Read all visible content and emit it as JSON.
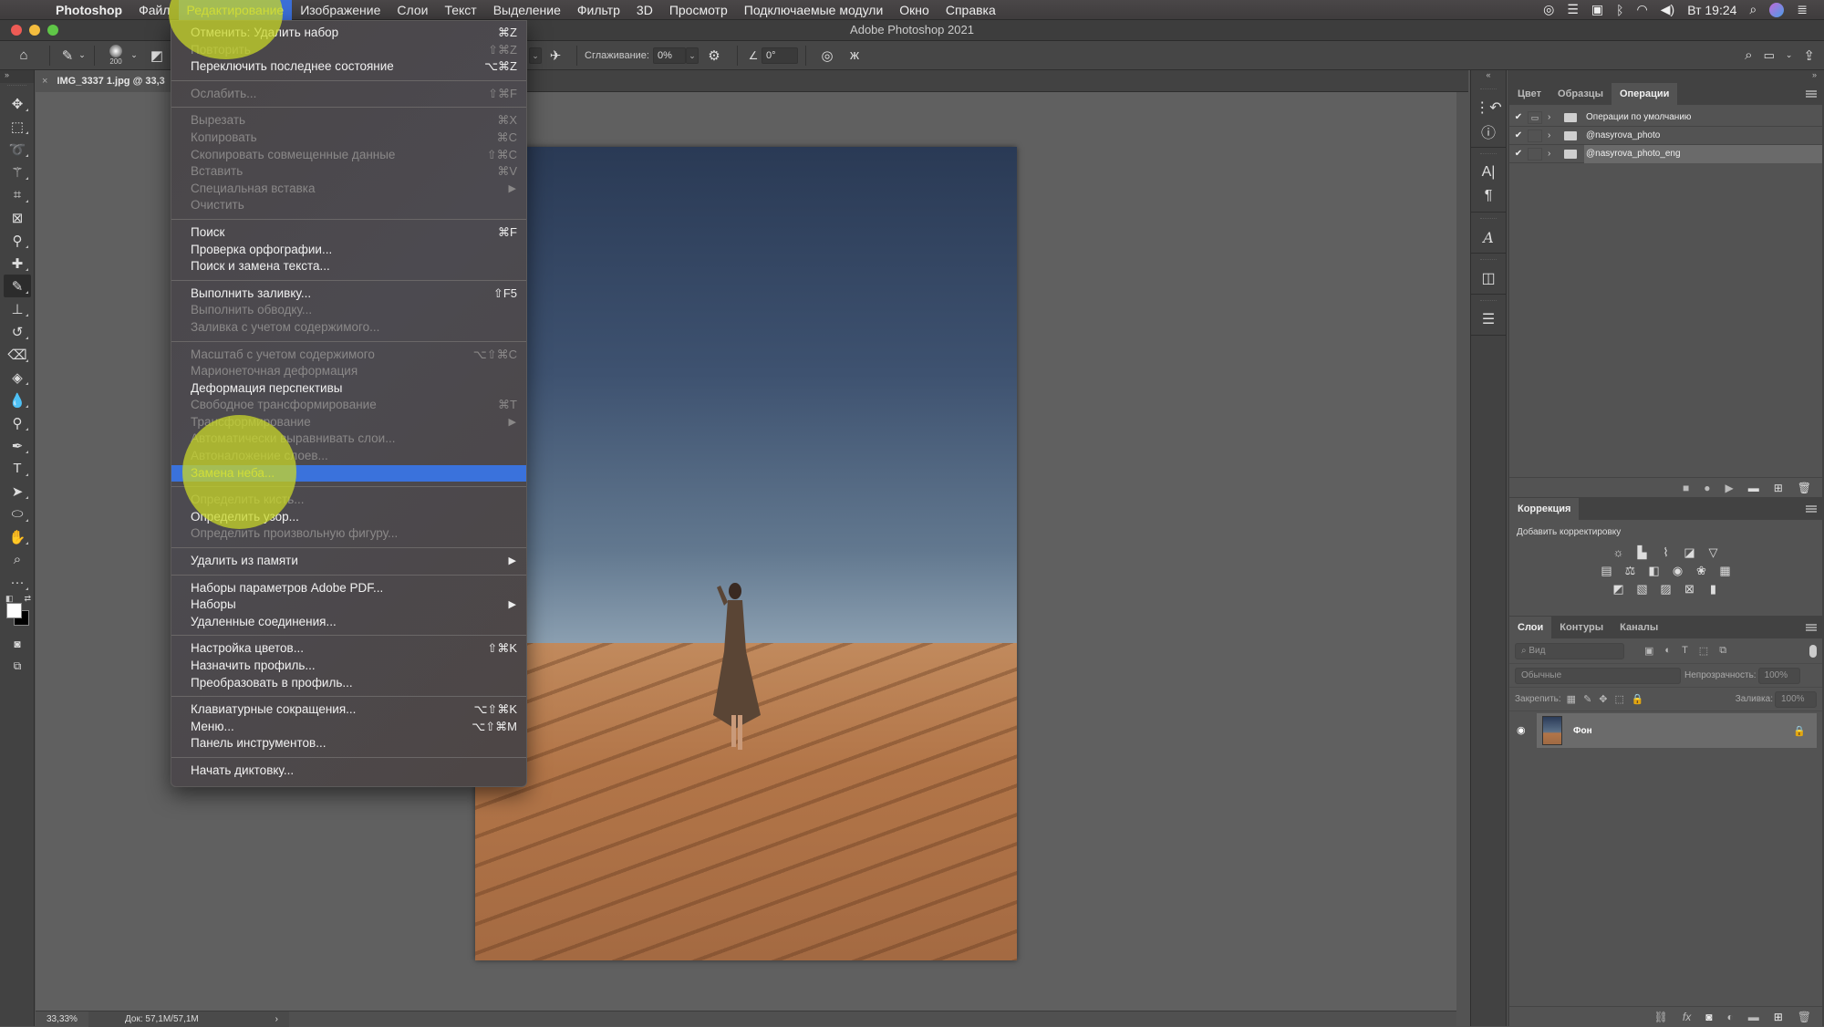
{
  "menubar": {
    "apple_icon": "apple-logo-icon",
    "app_name": "Photoshop",
    "items": [
      "Файл",
      "Редактирование",
      "Изображение",
      "Слои",
      "Текст",
      "Выделение",
      "Фильтр",
      "3D",
      "Просмотр",
      "Подключаемые модули",
      "Окно",
      "Справка"
    ],
    "active_item": "Редактирование",
    "status_icons": [
      "creative-cloud-icon",
      "drive-icon",
      "screenshot-app-icon",
      "bluetooth-icon",
      "wifi-icon",
      "volume-icon"
    ],
    "clock": "Вт 19:24",
    "right_icons": [
      "spotlight-icon",
      "siri-icon",
      "notification-center-icon"
    ]
  },
  "window": {
    "title": "Adobe Photoshop 2021"
  },
  "options_bar": {
    "brush_size": "200",
    "smoothing_label": "Сглаживание:",
    "smoothing_value": "0%",
    "angle_value": "0°"
  },
  "document": {
    "tab_title": "IMG_3337 1.jpg @ 33,3",
    "close_glyph": "×"
  },
  "status_bar": {
    "zoom": "33,33%",
    "doc_info": "Док: 57,1M/57,1M",
    "chevron": "›"
  },
  "edit_menu": {
    "groups": [
      [
        {
          "label": "Отменить: Удалить набор",
          "shortcut": "⌘Z",
          "enabled": true
        },
        {
          "label": "Повторить",
          "shortcut": "⇧⌘Z",
          "enabled": false
        },
        {
          "label": "Переключить последнее состояние",
          "shortcut": "⌥⌘Z",
          "enabled": true
        }
      ],
      [
        {
          "label": "Ослабить...",
          "shortcut": "⇧⌘F",
          "enabled": false
        }
      ],
      [
        {
          "label": "Вырезать",
          "shortcut": "⌘X",
          "enabled": false
        },
        {
          "label": "Копировать",
          "shortcut": "⌘C",
          "enabled": false
        },
        {
          "label": "Скопировать совмещенные данные",
          "shortcut": "⇧⌘C",
          "enabled": false
        },
        {
          "label": "Вставить",
          "shortcut": "⌘V",
          "enabled": false
        },
        {
          "label": "Специальная вставка",
          "submenu": true,
          "enabled": false
        },
        {
          "label": "Очистить",
          "enabled": false
        }
      ],
      [
        {
          "label": "Поиск",
          "shortcut": "⌘F",
          "enabled": true
        },
        {
          "label": "Проверка орфографии...",
          "enabled": true
        },
        {
          "label": "Поиск и замена текста...",
          "enabled": true
        }
      ],
      [
        {
          "label": "Выполнить заливку...",
          "shortcut": "⇧F5",
          "enabled": true
        },
        {
          "label": "Выполнить обводку...",
          "enabled": false
        },
        {
          "label": "Заливка с учетом содержимого...",
          "enabled": false
        }
      ],
      [
        {
          "label": "Масштаб с учетом содержимого",
          "shortcut": "⌥⇧⌘C",
          "enabled": false
        },
        {
          "label": "Марионеточная деформация",
          "enabled": false
        },
        {
          "label": "Деформация перспективы",
          "enabled": true
        },
        {
          "label": "Свободное трансформирование",
          "shortcut": "⌘T",
          "enabled": false
        },
        {
          "label": "Трансформирование",
          "submenu": true,
          "enabled": false
        },
        {
          "label": "Автоматически выравнивать слои...",
          "enabled": false
        },
        {
          "label": "Автоналожение слоев...",
          "enabled": false
        },
        {
          "label": "Замена неба...",
          "enabled": true,
          "highlighted": true
        }
      ],
      [
        {
          "label": "Определить кисть...",
          "enabled": false
        },
        {
          "label": "Определить узор...",
          "enabled": true
        },
        {
          "label": "Определить произвольную фигуру...",
          "enabled": false
        }
      ],
      [
        {
          "label": "Удалить из памяти",
          "submenu": true,
          "enabled": true
        }
      ],
      [
        {
          "label": "Наборы параметров Adobe PDF...",
          "enabled": true
        },
        {
          "label": "Наборы",
          "submenu": true,
          "enabled": true
        },
        {
          "label": "Удаленные соединения...",
          "enabled": true
        }
      ],
      [
        {
          "label": "Настройка цветов...",
          "shortcut": "⇧⌘K",
          "enabled": true
        },
        {
          "label": "Назначить профиль...",
          "enabled": true
        },
        {
          "label": "Преобразовать в профиль...",
          "enabled": true
        }
      ],
      [
        {
          "label": "Клавиатурные сокращения...",
          "shortcut": "⌥⇧⌘K",
          "enabled": true
        },
        {
          "label": "Меню...",
          "shortcut": "⌥⇧⌘M",
          "enabled": true
        },
        {
          "label": "Панель инструментов...",
          "enabled": true
        }
      ],
      [
        {
          "label": "Начать диктовку...",
          "enabled": true
        }
      ]
    ]
  },
  "toolbar": {
    "tools": [
      "move-tool",
      "marquee-tool",
      "lasso-tool",
      "magic-wand-tool",
      "crop-tool",
      "frame-tool",
      "eyedropper-tool",
      "healing-brush-tool",
      "brush-tool",
      "clone-stamp-tool",
      "history-brush-tool",
      "eraser-tool",
      "paint-bucket-tool",
      "blur-tool",
      "dodge-tool",
      "pen-tool",
      "type-tool",
      "path-selection-tool",
      "ellipse-tool",
      "hand-tool",
      "zoom-tool",
      "more-tools"
    ],
    "selected_tool": "brush-tool",
    "foreground_color": "#ffffff",
    "background_color": "#000000"
  },
  "actions_panel": {
    "tabs": [
      "Цвет",
      "Образцы",
      "Операции"
    ],
    "active_tab": "Операции",
    "sets": [
      {
        "name": "Операции по умолчанию",
        "checked": true,
        "selected": false
      },
      {
        "name": "@nasyrova_photo",
        "checked": true,
        "selected": false
      },
      {
        "name": "@nasyrova_photo_eng",
        "checked": true,
        "selected": true
      }
    ],
    "bottom_icons": [
      "stop-icon",
      "record-icon",
      "play-icon",
      "new-set-folder-icon",
      "new-action-icon",
      "delete-icon"
    ]
  },
  "adjustments_panel": {
    "tab": "Коррекция",
    "subtitle": "Добавить корректировку",
    "rows": [
      [
        "brightness-contrast-icon",
        "levels-icon",
        "curves-icon",
        "exposure-icon",
        "vibrance-icon"
      ],
      [
        "hue-saturation-icon",
        "color-balance-icon",
        "black-white-icon",
        "photo-filter-icon",
        "channel-mixer-icon",
        "color-lookup-icon"
      ],
      [
        "invert-icon",
        "posterize-icon",
        "threshold-icon",
        "selective-color-icon",
        "gradient-map-icon"
      ]
    ]
  },
  "layers_panel": {
    "tabs": [
      "Слои",
      "Контуры",
      "Каналы"
    ],
    "active_tab": "Слои",
    "filter_placeholder": "Вид",
    "blend_mode": "Обычные",
    "opacity_label": "Непрозрачность:",
    "opacity_value": "100%",
    "lock_label": "Закрепить:",
    "fill_label": "Заливка:",
    "fill_value": "100%",
    "layers": [
      {
        "name": "Фон",
        "visible": true,
        "locked": true
      }
    ],
    "bottom_icons": [
      "link-layers-icon",
      "fx-icon",
      "layer-mask-icon",
      "adjustment-layer-icon",
      "group-folder-icon",
      "new-layer-icon",
      "delete-icon"
    ]
  },
  "colors": {
    "menu_highlight": "#3a72dc",
    "click_indicator": "#c8d728",
    "canvas_bg": "#606060",
    "panel_bg": "#535353"
  }
}
